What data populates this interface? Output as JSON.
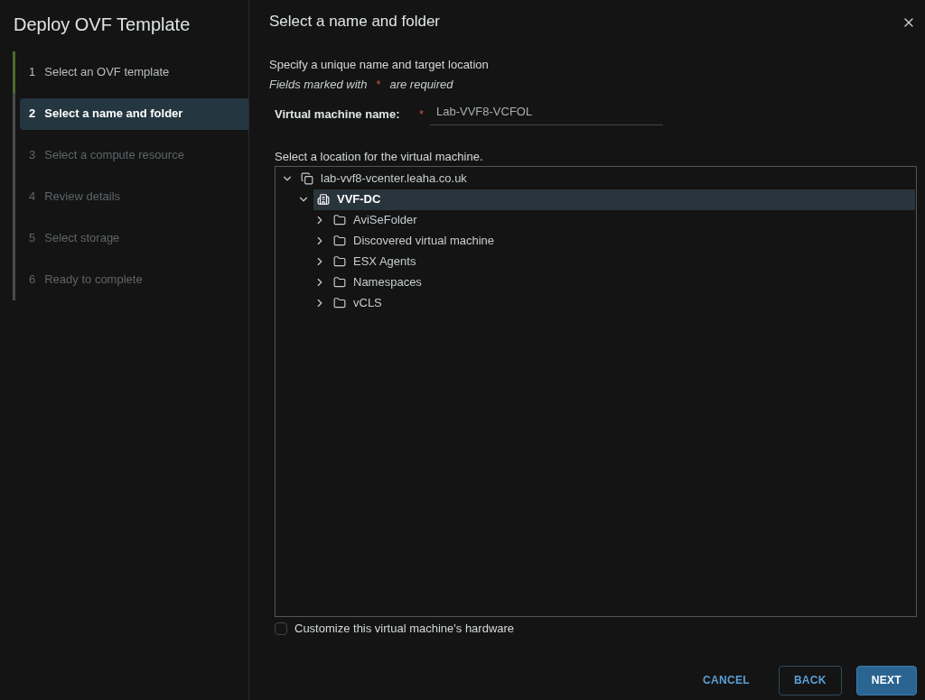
{
  "sidebar": {
    "title": "Deploy OVF Template",
    "steps": [
      {
        "number": "1",
        "label": "Select an OVF template",
        "selected": false,
        "completed": true,
        "disabled": false
      },
      {
        "number": "2",
        "label": "Select a name and folder",
        "selected": true,
        "completed": false,
        "disabled": false
      },
      {
        "number": "3",
        "label": "Select a compute resource",
        "selected": false,
        "completed": false,
        "disabled": true
      },
      {
        "number": "4",
        "label": "Review details",
        "selected": false,
        "completed": false,
        "disabled": true
      },
      {
        "number": "5",
        "label": "Select storage",
        "selected": false,
        "completed": false,
        "disabled": true
      },
      {
        "number": "6",
        "label": "Ready to complete",
        "selected": false,
        "completed": false,
        "disabled": true
      }
    ]
  },
  "main": {
    "title": "Select a name and folder",
    "subtitle": "Specify a unique name and target location",
    "required_note_before": "Fields marked with",
    "required_mark": "*",
    "required_note_after": "are required",
    "name_field": {
      "label": "Virtual machine name:",
      "required_mark": "*",
      "value": "Lab-VVF8-VCFOL"
    },
    "location_label": "Select a location for the virtual machine.",
    "tree": [
      {
        "kind": "vcenter",
        "label": "lab-vvf8-vcenter.leaha.co.uk",
        "expanded": true,
        "selected": false,
        "children": [
          {
            "kind": "datacenter",
            "label": "VVF-DC",
            "expanded": true,
            "selected": true,
            "children": [
              {
                "kind": "folder",
                "label": "AviSeFolder",
                "expanded": false,
                "selected": false
              },
              {
                "kind": "folder",
                "label": "Discovered virtual machine",
                "expanded": false,
                "selected": false
              },
              {
                "kind": "folder",
                "label": "ESX Agents",
                "expanded": false,
                "selected": false
              },
              {
                "kind": "folder",
                "label": "Namespaces",
                "expanded": false,
                "selected": false
              },
              {
                "kind": "folder",
                "label": "vCLS",
                "expanded": false,
                "selected": false
              }
            ]
          }
        ]
      }
    ],
    "customize_hardware": {
      "label": "Customize this virtual machine's hardware",
      "checked": false
    },
    "buttons": [
      {
        "kind": "link",
        "label": "CANCEL"
      },
      {
        "kind": "outline",
        "label": "BACK"
      },
      {
        "kind": "primary",
        "label": "NEXT"
      }
    ]
  }
}
